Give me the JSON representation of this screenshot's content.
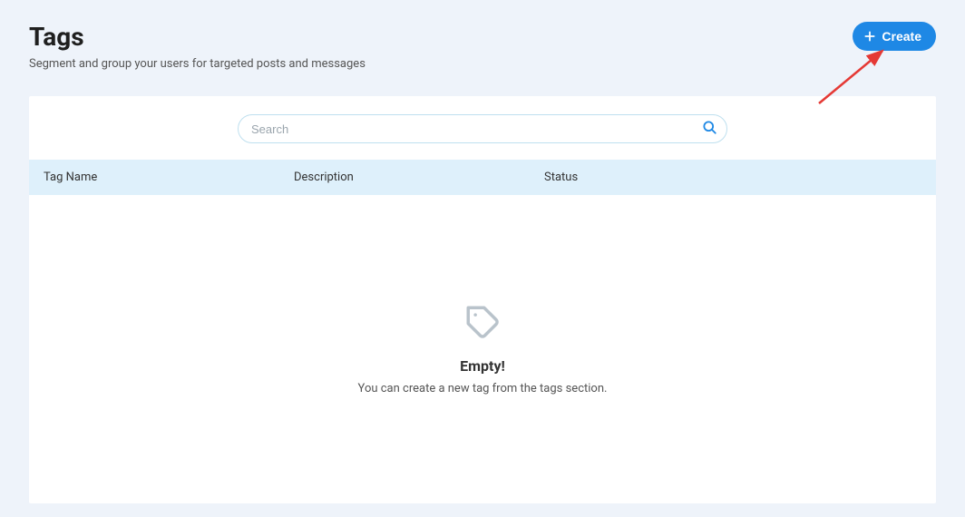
{
  "header": {
    "title": "Tags",
    "subtitle": "Segment and group your users for targeted posts and messages",
    "create_label": "Create"
  },
  "search": {
    "placeholder": "Search"
  },
  "table": {
    "columns": {
      "name": "Tag Name",
      "description": "Description",
      "status": "Status"
    }
  },
  "empty": {
    "title": "Empty!",
    "message": "You can create a new tag from the tags section."
  }
}
